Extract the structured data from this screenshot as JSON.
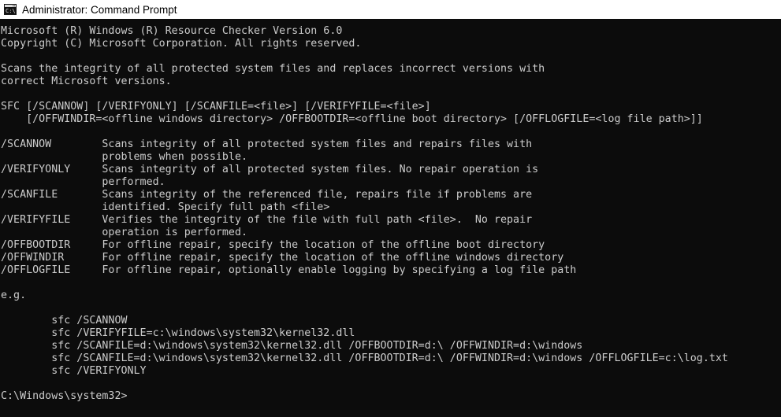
{
  "window": {
    "title": "Administrator: Command Prompt",
    "icon": "command-prompt-icon",
    "colors": {
      "titlebar_background": "#ffffff",
      "titlebar_text": "#000000",
      "console_background": "#0c0c0c",
      "console_text": "#cccccc"
    }
  },
  "console": {
    "header": {
      "line1": "Microsoft (R) Windows (R) Resource Checker Version 6.0",
      "line2": "Copyright (C) Microsoft Corporation. All rights reserved."
    },
    "description": [
      "Scans the integrity of all protected system files and replaces incorrect versions with",
      "correct Microsoft versions."
    ],
    "usage": [
      "SFC [/SCANNOW] [/VERIFYONLY] [/SCANFILE=<file>] [/VERIFYFILE=<file>]",
      "    [/OFFWINDIR=<offline windows directory> /OFFBOOTDIR=<offline boot directory> [/OFFLOGFILE=<log file path>]]"
    ],
    "switches": [
      {
        "name": "/SCANNOW",
        "description": [
          "Scans integrity of all protected system files and repairs files with",
          "problems when possible."
        ]
      },
      {
        "name": "/VERIFYONLY",
        "description": [
          "Scans integrity of all protected system files. No repair operation is",
          "performed."
        ]
      },
      {
        "name": "/SCANFILE",
        "description": [
          "Scans integrity of the referenced file, repairs file if problems are",
          "identified. Specify full path <file>"
        ]
      },
      {
        "name": "/VERIFYFILE",
        "description": [
          "Verifies the integrity of the file with full path <file>.  No repair",
          "operation is performed."
        ]
      },
      {
        "name": "/OFFBOOTDIR",
        "description": [
          "For offline repair, specify the location of the offline boot directory"
        ]
      },
      {
        "name": "/OFFWINDIR",
        "description": [
          "For offline repair, specify the location of the offline windows directory"
        ]
      },
      {
        "name": "/OFFLOGFILE",
        "description": [
          "For offline repair, optionally enable logging by specifying a log file path"
        ]
      }
    ],
    "examples_label": "e.g.",
    "examples": [
      "sfc /SCANNOW",
      "sfc /VERIFYFILE=c:\\windows\\system32\\kernel32.dll",
      "sfc /SCANFILE=d:\\windows\\system32\\kernel32.dll /OFFBOOTDIR=d:\\ /OFFWINDIR=d:\\windows",
      "sfc /SCANFILE=d:\\windows\\system32\\kernel32.dll /OFFBOOTDIR=d:\\ /OFFWINDIR=d:\\windows /OFFLOGFILE=c:\\log.txt",
      "sfc /VERIFYONLY"
    ],
    "prompt": "C:\\Windows\\system32>",
    "full_text": "Microsoft (R) Windows (R) Resource Checker Version 6.0\nCopyright (C) Microsoft Corporation. All rights reserved.\n\nScans the integrity of all protected system files and replaces incorrect versions with\ncorrect Microsoft versions.\n\nSFC [/SCANNOW] [/VERIFYONLY] [/SCANFILE=<file>] [/VERIFYFILE=<file>]\n    [/OFFWINDIR=<offline windows directory> /OFFBOOTDIR=<offline boot directory> [/OFFLOGFILE=<log file path>]]\n\n/SCANNOW        Scans integrity of all protected system files and repairs files with\n                problems when possible.\n/VERIFYONLY     Scans integrity of all protected system files. No repair operation is\n                performed.\n/SCANFILE       Scans integrity of the referenced file, repairs file if problems are\n                identified. Specify full path <file>\n/VERIFYFILE     Verifies the integrity of the file with full path <file>.  No repair\n                operation is performed.\n/OFFBOOTDIR     For offline repair, specify the location of the offline boot directory\n/OFFWINDIR      For offline repair, specify the location of the offline windows directory\n/OFFLOGFILE     For offline repair, optionally enable logging by specifying a log file path\n\ne.g.\n\n        sfc /SCANNOW\n        sfc /VERIFYFILE=c:\\windows\\system32\\kernel32.dll\n        sfc /SCANFILE=d:\\windows\\system32\\kernel32.dll /OFFBOOTDIR=d:\\ /OFFWINDIR=d:\\windows\n        sfc /SCANFILE=d:\\windows\\system32\\kernel32.dll /OFFBOOTDIR=d:\\ /OFFWINDIR=d:\\windows /OFFLOGFILE=c:\\log.txt\n        sfc /VERIFYONLY\n\nC:\\Windows\\system32>"
  }
}
